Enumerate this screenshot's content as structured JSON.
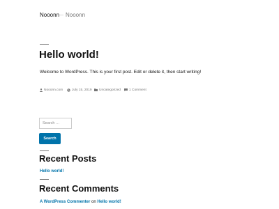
{
  "header": {
    "site_title": "Nooonn",
    "separator": "—",
    "site_description": "Nooonn"
  },
  "post": {
    "title": "Hello world!",
    "content": "Welcome to WordPress. This is your first post. Edit or delete it, then start writing!",
    "meta": {
      "author": "Nooonn.com",
      "date": "July 15, 2019",
      "category": "Uncategorized",
      "comments": "1 Comment"
    }
  },
  "search": {
    "placeholder": "Search …",
    "button_label": "Search"
  },
  "widgets": {
    "recent_posts": {
      "title": "Recent Posts",
      "items": [
        "Hello world!"
      ]
    },
    "recent_comments": {
      "title": "Recent Comments",
      "items": [
        {
          "author": "A WordPress Commenter",
          "connector": "on",
          "post": "Hello world!"
        }
      ]
    }
  },
  "colors": {
    "accent": "#0073aa",
    "text": "#111111",
    "muted": "#767676"
  }
}
